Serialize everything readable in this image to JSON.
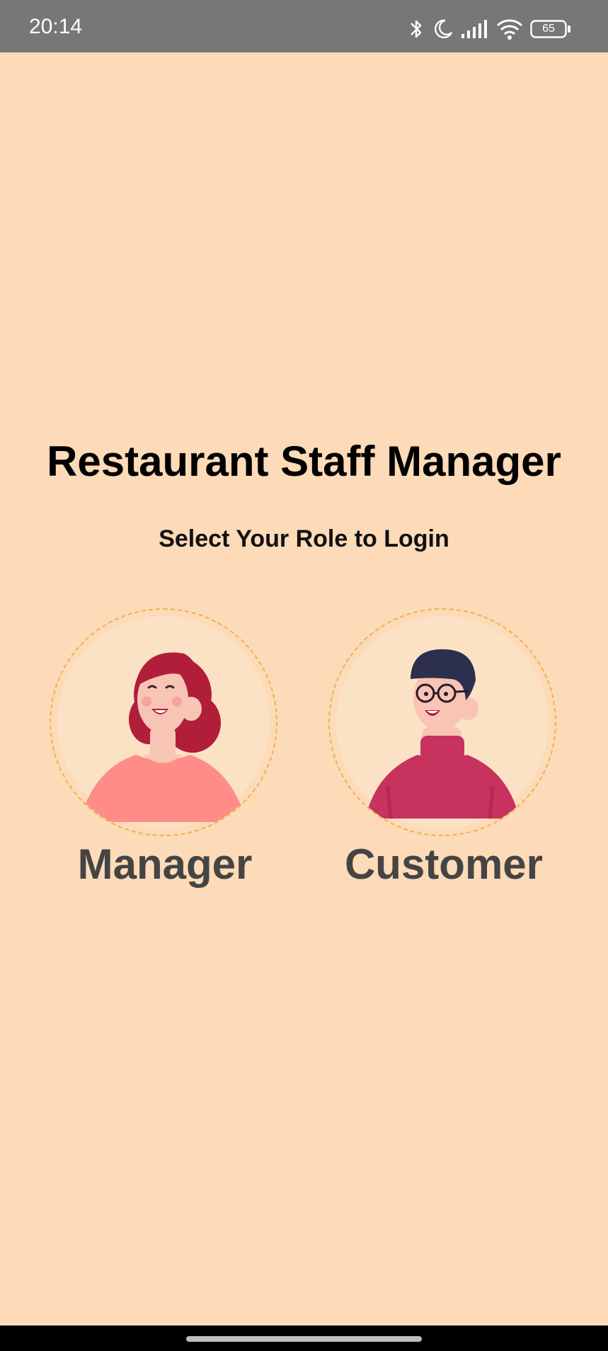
{
  "status_bar": {
    "time": "20:14",
    "battery": "65",
    "icons": [
      "bluetooth-icon",
      "moon-icon",
      "signal-icon",
      "wifi-icon",
      "battery-icon"
    ]
  },
  "header": {
    "title": "Restaurant Staff Manager",
    "subtitle": "Select Your Role to Login"
  },
  "roles": [
    {
      "label": "Manager",
      "avatar": "woman-avatar"
    },
    {
      "label": "Customer",
      "avatar": "man-avatar"
    }
  ],
  "colors": {
    "background": "#FDDAB8",
    "status_bar": "#777777",
    "avatar_border": "#F0B24A",
    "avatar_fill": "#FCE2C4",
    "role_label": "#444444"
  }
}
